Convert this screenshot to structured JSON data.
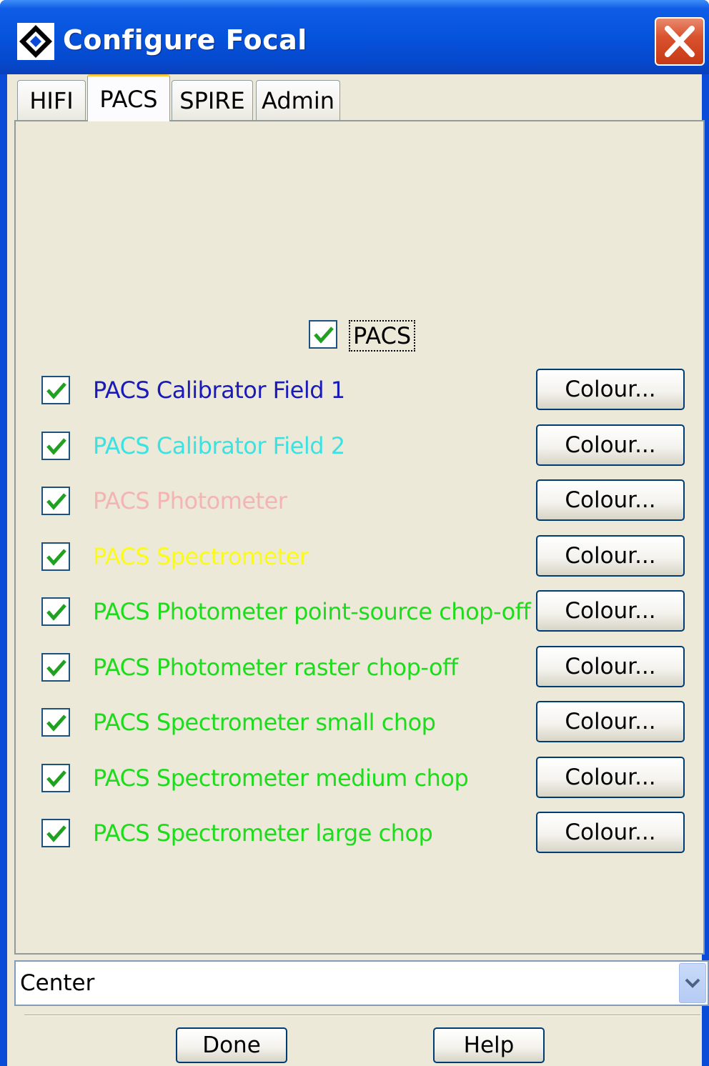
{
  "window": {
    "title": "Configure Focal",
    "icon": "app-diamond-icon",
    "close_icon": "close-x-icon"
  },
  "tabs": [
    {
      "label": "HIFI",
      "active": false
    },
    {
      "label": "PACS",
      "active": true
    },
    {
      "label": "SPIRE",
      "active": false
    },
    {
      "label": "Admin",
      "active": false
    }
  ],
  "pacs_panel": {
    "master": {
      "label": "PACS",
      "checked": true
    },
    "rows": [
      {
        "label": "PACS Calibrator Field 1",
        "checked": true,
        "color": "#1a1ab8",
        "button": "Colour..."
      },
      {
        "label": "PACS Calibrator Field 2",
        "checked": true,
        "color": "#3ce2e2",
        "button": "Colour..."
      },
      {
        "label": "PACS Photometer",
        "checked": true,
        "color": "#f2b4b4",
        "button": "Colour..."
      },
      {
        "label": "PACS Spectrometer",
        "checked": true,
        "color": "#fafa1c",
        "button": "Colour..."
      },
      {
        "label": "PACS Photometer point-source chop-off",
        "checked": true,
        "color": "#1cdc1c",
        "button": "Colour..."
      },
      {
        "label": "PACS Photometer raster chop-off",
        "checked": true,
        "color": "#1cdc1c",
        "button": "Colour..."
      },
      {
        "label": "PACS Spectrometer small chop",
        "checked": true,
        "color": "#1cdc1c",
        "button": "Colour..."
      },
      {
        "label": "PACS Spectrometer medium chop",
        "checked": true,
        "color": "#1cdc1c",
        "button": "Colour..."
      },
      {
        "label": "PACS Spectrometer large chop",
        "checked": true,
        "color": "#1cdc1c",
        "button": "Colour..."
      }
    ]
  },
  "position_select": {
    "value": "Center",
    "icon": "chevron-down-icon"
  },
  "buttons": {
    "done": "Done",
    "help": "Help"
  },
  "colors": {
    "titlebar": "#0653dc",
    "dialog_bg": "#ece9d8",
    "checkmark": "#21a121",
    "active_tab_accent": "#ffc83c"
  }
}
